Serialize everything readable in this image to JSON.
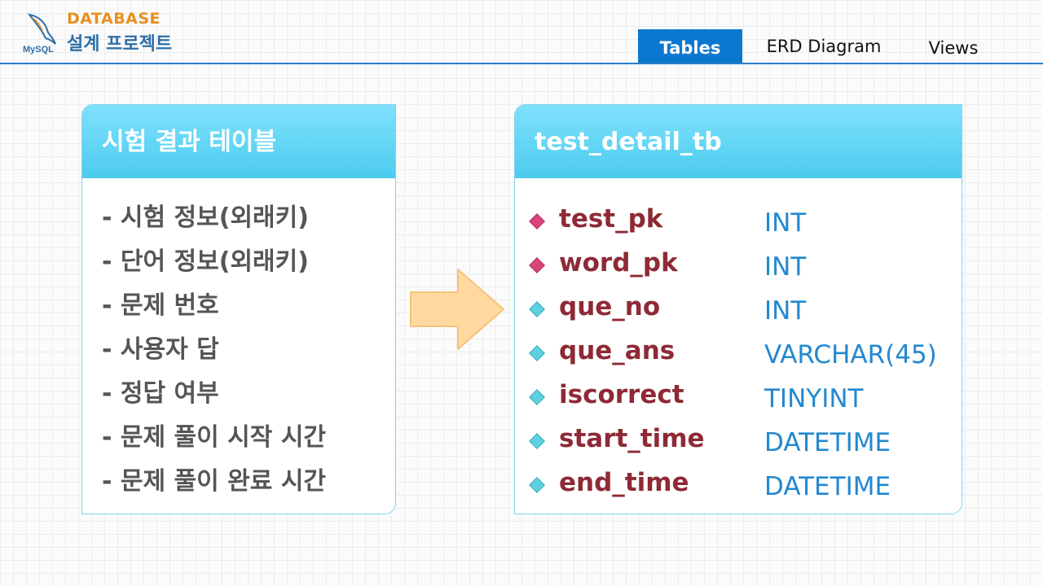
{
  "logo": {
    "brand": "MySQL",
    "title": "DATABASE",
    "subtitle": "설계 프로젝트"
  },
  "nav": {
    "tabs": [
      "Tables",
      "ERD Diagram",
      "Views"
    ]
  },
  "description_table": {
    "header": "시험 결과 테이블",
    "items": [
      "- 시험 정보(외래키)",
      "- 단어 정보(외래키)",
      "- 문제 번호",
      "- 사용자 답",
      "- 정답 여부",
      "- 문제 풀이 시작 시간",
      "- 문제 풀이 완료 시간"
    ]
  },
  "schema_table": {
    "header": "test_detail_tb",
    "fields": [
      {
        "name": "test_pk",
        "type": "INT",
        "key": "pk"
      },
      {
        "name": "word_pk",
        "type": "INT",
        "key": "pk"
      },
      {
        "name": "que_no",
        "type": "INT",
        "key": "col"
      },
      {
        "name": "que_ans",
        "type": "VARCHAR(45)",
        "key": "col"
      },
      {
        "name": "iscorrect",
        "type": "TINYINT",
        "key": "col"
      },
      {
        "name": "start_time",
        "type": "DATETIME",
        "key": "col"
      },
      {
        "name": "end_time",
        "type": "DATETIME",
        "key": "col"
      }
    ]
  },
  "colors": {
    "accent": "#0b78d0",
    "header_gradient_top": "#7fe1fc",
    "header_gradient_bottom": "#4ccbef",
    "pk_marker": "#d7457a",
    "col_marker": "#5fd0e0",
    "field_name": "#8e2a35",
    "field_type": "#2388d0",
    "arrow": "#ffd9a0"
  }
}
